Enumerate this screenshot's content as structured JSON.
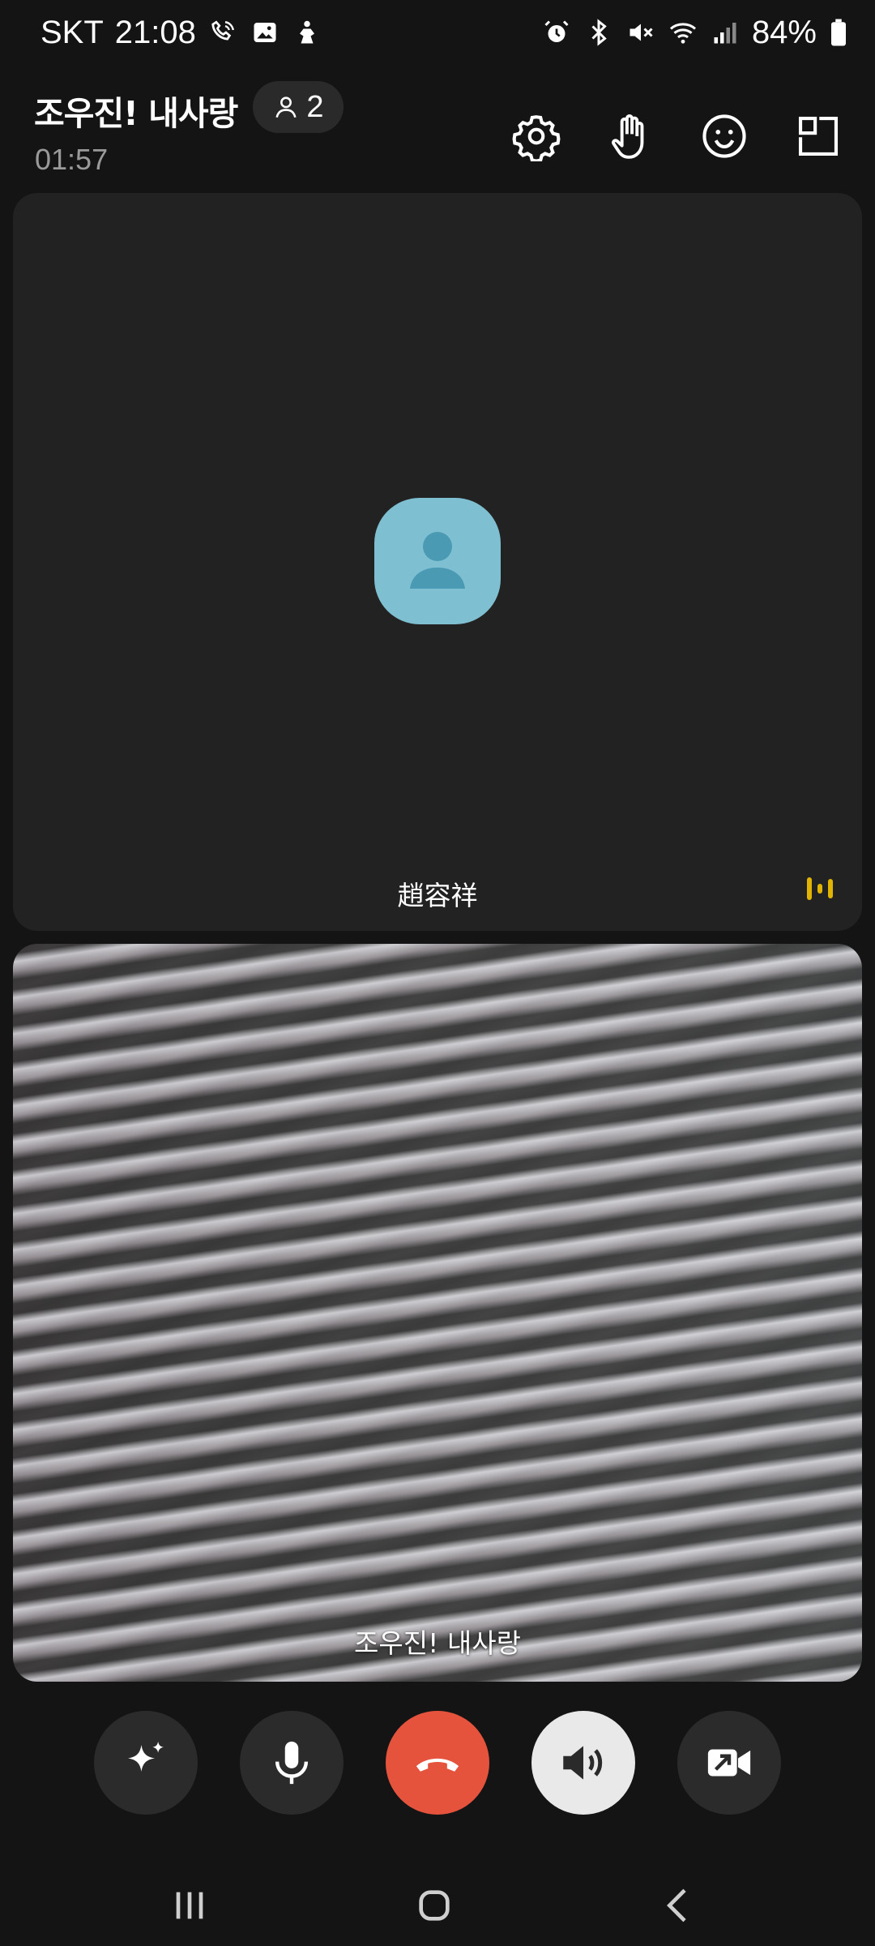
{
  "status_bar": {
    "carrier": "SKT",
    "time": "21:08",
    "battery": "84%",
    "left_icons": [
      "call-icon",
      "gallery-icon",
      "figure-icon"
    ],
    "right_icons": [
      "alarm-icon",
      "bluetooth-icon",
      "mute-icon",
      "wifi-icon",
      "signal-icon",
      "battery-icon"
    ]
  },
  "header": {
    "title": "조우진! 내사랑",
    "participants_count": "2",
    "duration": "01:57",
    "actions": [
      "settings-icon",
      "raise-hand-icon",
      "emoji-icon",
      "layout-icon"
    ]
  },
  "tiles": [
    {
      "name": "趙容祥",
      "video": false,
      "speaking": true
    },
    {
      "name": "조우진! 내사랑",
      "video": true,
      "speaking": false
    }
  ],
  "controls": [
    {
      "icon": "effects-icon"
    },
    {
      "icon": "microphone-icon"
    },
    {
      "icon": "end-call-icon"
    },
    {
      "icon": "speaker-icon",
      "active": true
    },
    {
      "icon": "video-off-icon"
    }
  ],
  "colors": {
    "background": "#141414",
    "tile": "#222222",
    "end_call": "#e5533d",
    "avatar": "#7ebfd2",
    "speaking": "#e0b400",
    "speaker_active": "#e9e9e9"
  },
  "nav_bar": [
    "recents-icon",
    "home-icon",
    "back-icon"
  ]
}
